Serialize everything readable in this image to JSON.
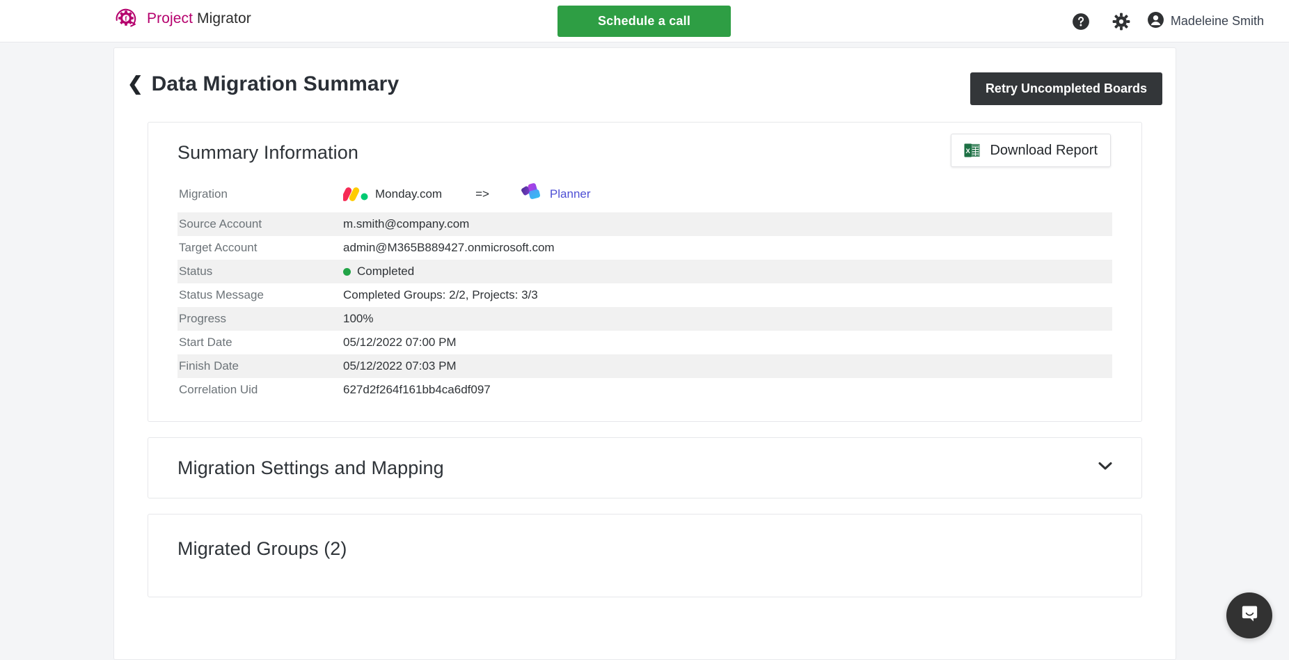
{
  "header": {
    "brand_primary": "Project",
    "brand_secondary": " Migrator",
    "brand_logo_icon": "gear-refresh-logo-icon",
    "schedule_button": "Schedule a call",
    "help_icon": "help-circle-icon",
    "settings_icon": "gear-icon",
    "account_icon": "user-avatar-icon",
    "user_name": "Madeleine Smith",
    "brand_color": "#b5006d",
    "schedule_button_color": "#2e9e44"
  },
  "page": {
    "back_icon": "chevron-left-icon",
    "title": "Data Migration Summary",
    "retry_button": "Retry Uncompleted Boards",
    "retry_button_color": "#333639"
  },
  "summary": {
    "title": "Summary Information",
    "download_button": "Download Report",
    "download_icon": "excel-file-icon",
    "migration": {
      "label": "Migration",
      "source_name": "Monday.com",
      "source_icon": "monday-com-logo-icon",
      "arrow": "=>",
      "target_name": "Planner",
      "target_icon": "microsoft-planner-logo-icon"
    },
    "rows": [
      {
        "key": "Source Account",
        "value": "m.smith@company.com"
      },
      {
        "key": "Target Account",
        "value": "admin@M365B889427.onmicrosoft.com"
      },
      {
        "key": "Status",
        "value": "Completed",
        "status_dot": "#22a447"
      },
      {
        "key": "Status Message",
        "value": "Completed Groups: 2/2, Projects: 3/3"
      },
      {
        "key": "Progress",
        "value": "100%"
      },
      {
        "key": "Start Date",
        "value": "05/12/2022 07:00 PM"
      },
      {
        "key": "Finish Date",
        "value": "05/12/2022 07:03 PM"
      },
      {
        "key": "Correlation Uid",
        "value": "627d2f264f161bb4ca6df097"
      }
    ]
  },
  "settings_panel": {
    "title": "Migration Settings and Mapping",
    "chevron_icon": "chevron-down-icon"
  },
  "groups_panel": {
    "title": "Migrated Groups (2)"
  },
  "chat": {
    "icon": "chat-bubble-icon"
  }
}
